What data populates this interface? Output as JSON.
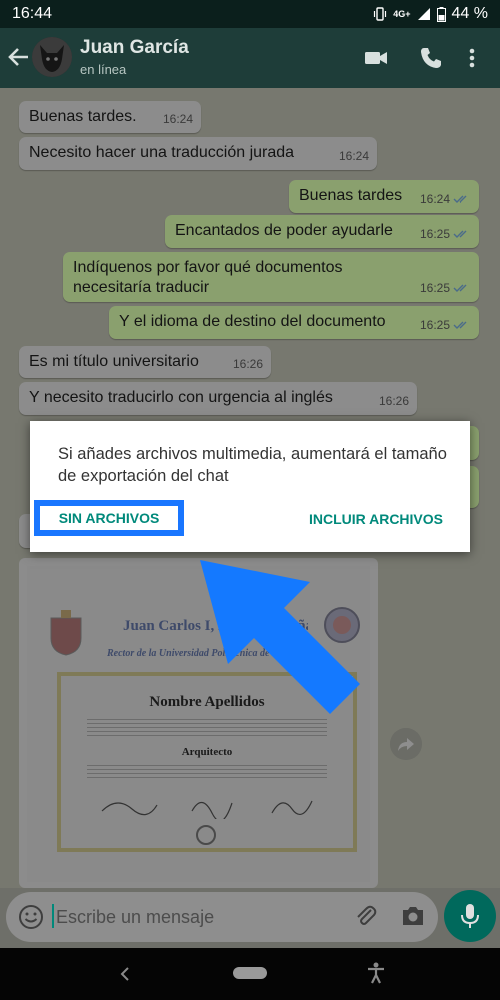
{
  "status": {
    "time": "16:44",
    "network": "4G+",
    "battery": "44 %"
  },
  "header": {
    "contact_name": "Juan García",
    "contact_status": "en línea"
  },
  "messages": [
    {
      "text": "Buenas tardes.",
      "time": "16:24",
      "dir": "in"
    },
    {
      "text": "Necesito hacer una traducción jurada",
      "time": "16:24",
      "dir": "in"
    },
    {
      "text": "Buenas tardes",
      "time": "16:24",
      "dir": "out"
    },
    {
      "text": "Encantados de poder ayudarle",
      "time": "16:25",
      "dir": "out"
    },
    {
      "text": "Indíquenos por favor qué documentos necesitaría traducir",
      "time": "16:25",
      "dir": "out"
    },
    {
      "text": "Y el idioma de destino del documento",
      "time": "16:25",
      "dir": "out"
    },
    {
      "text": "Es mi título universitario",
      "time": "16:26",
      "dir": "in"
    },
    {
      "text": "Y necesito traducirlo con urgencia al inglés",
      "time": "16:26",
      "dir": "in"
    }
  ],
  "diploma": {
    "header": "Juan Carlos I, Rey de España",
    "subheader": "Rector de la Universidad Politécnica de Madrid",
    "name": "Nombre Apellidos",
    "degree": "Arquitecto"
  },
  "dialog": {
    "message": "Si añades archivos multimedia, aumentará el tamaño de exportación del chat",
    "no_files_label": "SIN ARCHIVOS",
    "include_files_label": "INCLUIR ARCHIVOS"
  },
  "composer": {
    "placeholder": "Escribe un mensaje"
  },
  "colors": {
    "accent": "#00897b",
    "highlight": "#1976ff",
    "arrow": "#1479ff",
    "header": "#1e3d39"
  }
}
